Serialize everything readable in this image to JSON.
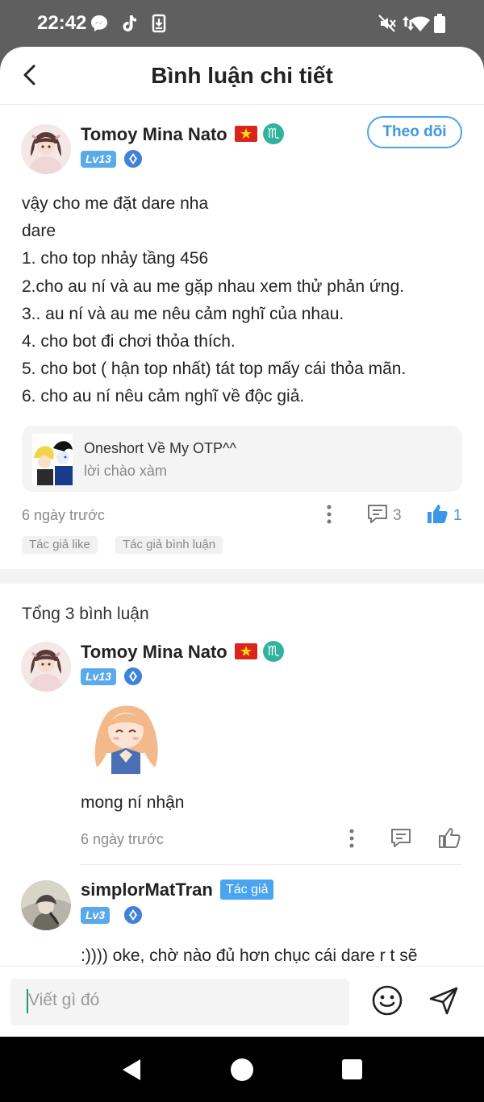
{
  "status_bar": {
    "time": "22:42",
    "left_icons": [
      "messenger-icon",
      "tiktok-icon",
      "download-icon"
    ],
    "right_icons": [
      "mute-icon",
      "data-arrows-icon",
      "wifi-icon",
      "battery-icon"
    ]
  },
  "header": {
    "title": "Bình luận chi tiết"
  },
  "post": {
    "author": {
      "name": "Tomoy Mina Nato",
      "level": "Lv13"
    },
    "follow_label": "Theo dõi",
    "lines": [
      "vậy cho me đặt dare nha",
      "dare",
      "1. cho top nhảy tầng 456",
      "2.cho au ní và au me gặp nhau xem thử phản ứng.",
      "3.. au ní và au me nêu cảm nghĩ của nhau.",
      "4. cho bot đi chơi thỏa thích.",
      "5. cho bot ( hận top nhất) tát top mấy cái thỏa mãn.",
      "6. cho au ní nêu cảm nghĩ về độc giả."
    ],
    "story": {
      "title": "Oneshort Về My OTP^^",
      "subtitle": "lời chào xàm"
    },
    "time": "6 ngày trước",
    "comment_count": "3",
    "like_count": "1",
    "tags": [
      "Tác giả like",
      "Tác giả bình luận"
    ]
  },
  "replies_total": "Tổng 3 bình luận",
  "replies": [
    {
      "author": {
        "name": "Tomoy Mina Nato",
        "level": "Lv13"
      },
      "text": "mong ní nhận",
      "time": "6 ngày trước"
    },
    {
      "author": {
        "name": "simplorMatTran",
        "level": "Lv3",
        "badge": "Tác giả"
      },
      "text": ":)))) oke, chờ nào đủ hơn chục cái dare r t sẽ"
    }
  ],
  "composer": {
    "placeholder": "Viết gì đó"
  },
  "colors": {
    "accent": "#4aa4f0",
    "flag_red": "#da251d",
    "zodiac": "#2fb39b"
  }
}
